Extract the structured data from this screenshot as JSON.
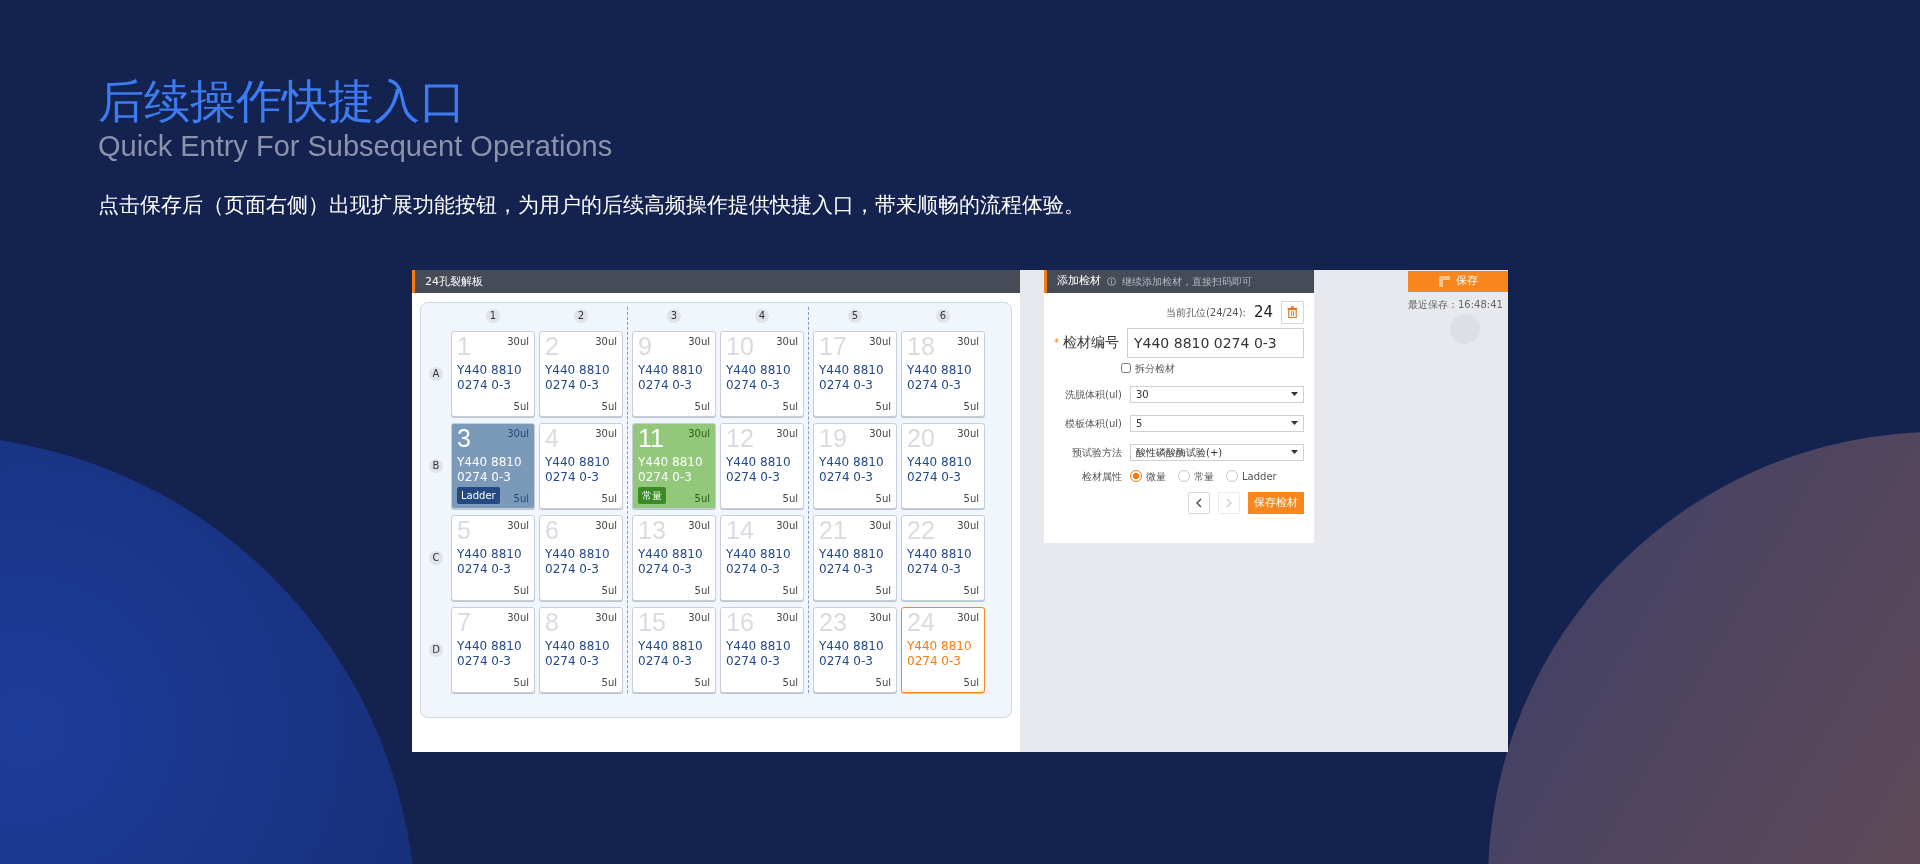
{
  "slide": {
    "title": "后续操作快捷入口",
    "subtitle": "Quick Entry For Subsequent Operations",
    "description": "点击保存后（页面右侧）出现扩展功能按钮，为用户的后续高频操作提供快捷入口，带来顺畅的流程体验。"
  },
  "plate_panel": {
    "title": "24孔裂解板",
    "columns": [
      "1",
      "2",
      "3",
      "4",
      "5",
      "6"
    ],
    "rows": [
      {
        "label": "A",
        "wells": [
          {
            "number": "1",
            "top": "30ul",
            "sample": "Y440 8810 0274 0-3",
            "bottom": "5ul",
            "kind": "normal"
          },
          {
            "number": "2",
            "top": "30ul",
            "sample": "Y440 8810 0274 0-3",
            "bottom": "5ul",
            "kind": "normal"
          },
          {
            "number": "9",
            "top": "30ul",
            "sample": "Y440 8810 0274 0-3",
            "bottom": "5ul",
            "kind": "normal"
          },
          {
            "number": "10",
            "top": "30ul",
            "sample": "Y440 8810 0274 0-3",
            "bottom": "5ul",
            "kind": "normal"
          },
          {
            "number": "17",
            "top": "30ul",
            "sample": "Y440 8810 0274 0-3",
            "bottom": "5ul",
            "kind": "normal"
          },
          {
            "number": "18",
            "top": "30ul",
            "sample": "Y440 8810 0274 0-3",
            "bottom": "5ul",
            "kind": "normal"
          }
        ]
      },
      {
        "label": "B",
        "wells": [
          {
            "number": "3",
            "top": "30ul",
            "sample": "Y440 8810 0274 0-3",
            "bottom": "5ul",
            "kind": "ladder",
            "tag": "Ladder"
          },
          {
            "number": "4",
            "top": "30ul",
            "sample": "Y440 8810 0274 0-3",
            "bottom": "5ul",
            "kind": "normal"
          },
          {
            "number": "11",
            "top": "30ul",
            "sample": "Y440 8810 0274 0-3",
            "bottom": "5ul",
            "kind": "constant",
            "tag": "常量"
          },
          {
            "number": "12",
            "top": "30ul",
            "sample": "Y440 8810 0274 0-3",
            "bottom": "5ul",
            "kind": "normal"
          },
          {
            "number": "19",
            "top": "30ul",
            "sample": "Y440 8810 0274 0-3",
            "bottom": "5ul",
            "kind": "normal"
          },
          {
            "number": "20",
            "top": "30ul",
            "sample": "Y440 8810 0274 0-3",
            "bottom": "5ul",
            "kind": "normal"
          }
        ]
      },
      {
        "label": "C",
        "wells": [
          {
            "number": "5",
            "top": "30ul",
            "sample": "Y440 8810 0274 0-3",
            "bottom": "5ul",
            "kind": "normal"
          },
          {
            "number": "6",
            "top": "30ul",
            "sample": "Y440 8810 0274 0-3",
            "bottom": "5ul",
            "kind": "normal"
          },
          {
            "number": "13",
            "top": "30ul",
            "sample": "Y440 8810 0274 0-3",
            "bottom": "5ul",
            "kind": "normal"
          },
          {
            "number": "14",
            "top": "30ul",
            "sample": "Y440 8810 0274 0-3",
            "bottom": "5ul",
            "kind": "normal"
          },
          {
            "number": "21",
            "top": "30ul",
            "sample": "Y440 8810 0274 0-3",
            "bottom": "5ul",
            "kind": "normal"
          },
          {
            "number": "22",
            "top": "30ul",
            "sample": "Y440 8810 0274 0-3",
            "bottom": "5ul",
            "kind": "normal"
          }
        ]
      },
      {
        "label": "D",
        "wells": [
          {
            "number": "7",
            "top": "30ul",
            "sample": "Y440 8810 0274 0-3",
            "bottom": "5ul",
            "kind": "normal"
          },
          {
            "number": "8",
            "top": "30ul",
            "sample": "Y440 8810 0274 0-3",
            "bottom": "5ul",
            "kind": "normal"
          },
          {
            "number": "15",
            "top": "30ul",
            "sample": "Y440 8810 0274 0-3",
            "bottom": "5ul",
            "kind": "normal"
          },
          {
            "number": "16",
            "top": "30ul",
            "sample": "Y440 8810 0274 0-3",
            "bottom": "5ul",
            "kind": "normal"
          },
          {
            "number": "23",
            "top": "30ul",
            "sample": "Y440 8810 0274 0-3",
            "bottom": "5ul",
            "kind": "normal"
          },
          {
            "number": "24",
            "top": "30ul",
            "sample": "Y440 8810 0274 0-3",
            "bottom": "5ul",
            "kind": "selected"
          }
        ]
      }
    ]
  },
  "form_panel": {
    "title": "添加检材",
    "hint": "继续添加检材，直接扫码即可",
    "position_label": "当前孔位(24/24):",
    "position_value": "24",
    "required_mark": "*",
    "sample_label": "检材编号",
    "sample_value": "Y440 8810 0274 0-3",
    "split": {
      "label": "拆分检材",
      "checked": false
    },
    "selects": [
      {
        "label": "洗脱体积(ul)",
        "value": "30"
      },
      {
        "label": "模板体积(ul)",
        "value": "5"
      },
      {
        "label": "预试验方法",
        "value": "酸性磷酸酶试验(+)"
      }
    ],
    "attribute": {
      "label": "检材属性",
      "options": [
        {
          "label": "微量",
          "selected": true
        },
        {
          "label": "常量",
          "selected": false
        },
        {
          "label": "Ladder",
          "selected": false
        }
      ]
    },
    "prev_disabled": false,
    "next_disabled": true,
    "save_button": "保存检材"
  },
  "save": {
    "button": "保存",
    "last_saved": "最近保存：16:48:41"
  }
}
